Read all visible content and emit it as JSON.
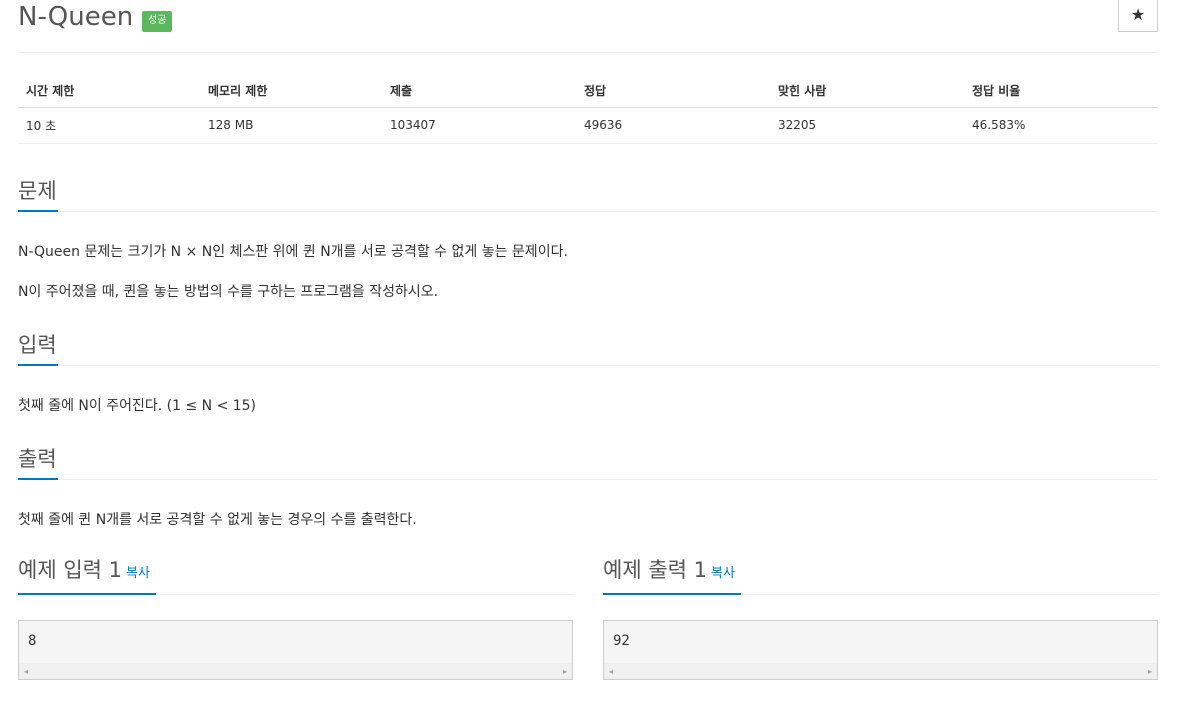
{
  "problem": {
    "title": "N-Queen",
    "status_badge": "성공",
    "star_icon": "★"
  },
  "info_table": {
    "headers": [
      "시간 제한",
      "메모리 제한",
      "제출",
      "정답",
      "맞힌 사람",
      "정답 비율"
    ],
    "values": [
      "10 초",
      "128 MB",
      "103407",
      "49636",
      "32205",
      "46.583%"
    ]
  },
  "sections": {
    "problem": {
      "heading": "문제",
      "paragraphs": [
        "N-Queen 문제는 크기가 N × N인 체스판 위에 퀸 N개를 서로 공격할 수 없게 놓는 문제이다.",
        "N이 주어졌을 때, 퀸을 놓는 방법의 수를 구하는 프로그램을 작성하시오."
      ]
    },
    "input": {
      "heading": "입력",
      "text": "첫째 줄에 N이 주어진다. (1 ≤ N < 15)"
    },
    "output": {
      "heading": "출력",
      "text": "첫째 줄에 퀸 N개를 서로 공격할 수 없게 놓는 경우의 수를 출력한다."
    }
  },
  "samples": {
    "input": {
      "heading": "예제 입력 1",
      "copy_label": "복사",
      "content": "8"
    },
    "output": {
      "heading": "예제 출력 1",
      "copy_label": "복사",
      "content": "92"
    }
  },
  "scroll_arrows": {
    "left": "◂",
    "right": "▸"
  },
  "colors": {
    "accent": "#0076c0",
    "success": "#5cb85c"
  }
}
